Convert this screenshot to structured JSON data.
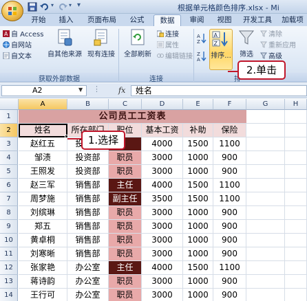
{
  "window": {
    "title": "根据单元格颜色排序.xlsx - Mi"
  },
  "tabs": [
    {
      "label": "开始"
    },
    {
      "label": "插入"
    },
    {
      "label": "页面布局"
    },
    {
      "label": "公式"
    },
    {
      "label": "数据",
      "active": true
    },
    {
      "label": "审阅"
    },
    {
      "label": "视图"
    },
    {
      "label": "开发工具"
    },
    {
      "label": "加载项"
    }
  ],
  "ribbon": {
    "get_external": {
      "caption": "获取外部数据",
      "access": "自 Access",
      "web": "自网站",
      "text": "自文本",
      "other_sources": "自其他来源",
      "existing": "现有连接"
    },
    "connections": {
      "caption": "连接",
      "refresh_all": "全部刷新",
      "connections": "连接",
      "properties": "属性",
      "edit_links": "编辑链接"
    },
    "sort_filter": {
      "caption": "排",
      "sort": "排序...",
      "filter": "筛选",
      "clear": "清除",
      "reapply": "重新应用",
      "advanced": "高级"
    }
  },
  "formula_bar": {
    "name_box": "A2",
    "fx": "fx",
    "content": "姓名"
  },
  "sheet": {
    "columns": [
      "A",
      "B",
      "C",
      "D",
      "E",
      "F",
      "G",
      "H"
    ],
    "title": "公司员工工资表",
    "headers": [
      "姓名",
      "所在部门",
      "职位",
      "基本工资",
      "补助",
      "保险"
    ],
    "rows": [
      {
        "n": "1"
      },
      {
        "n": "2"
      },
      {
        "n": "3",
        "cells": [
          "赵红五",
          "投资部",
          "",
          "4000",
          "1500",
          "1100"
        ],
        "post_style": "post-dark"
      },
      {
        "n": "4",
        "cells": [
          "邹渍",
          "投资部",
          "职员",
          "3000",
          "1000",
          "900"
        ],
        "post_style": "post"
      },
      {
        "n": "5",
        "cells": [
          "王照发",
          "投资部",
          "职员",
          "3000",
          "1000",
          "900"
        ],
        "post_style": "post"
      },
      {
        "n": "6",
        "cells": [
          "赵三军",
          "销售部",
          "主任",
          "4000",
          "1500",
          "1100"
        ],
        "post_style": "post-dark"
      },
      {
        "n": "7",
        "cells": [
          "周梦施",
          "销售部",
          "副主任",
          "3500",
          "1500",
          "1100"
        ],
        "post_style": "post-dark"
      },
      {
        "n": "8",
        "cells": [
          "刘缤琳",
          "销售部",
          "职员",
          "3000",
          "1000",
          "900"
        ],
        "post_style": "post"
      },
      {
        "n": "9",
        "cells": [
          "郑五",
          "销售部",
          "职员",
          "3000",
          "1000",
          "900"
        ],
        "post_style": "post"
      },
      {
        "n": "10",
        "cells": [
          "黄卓桐",
          "销售部",
          "职员",
          "3000",
          "1000",
          "900"
        ],
        "post_style": "post"
      },
      {
        "n": "11",
        "cells": [
          "刘寒晰",
          "销售部",
          "职员",
          "3000",
          "1000",
          "900"
        ],
        "post_style": "post"
      },
      {
        "n": "12",
        "cells": [
          "张家艳",
          "办公室",
          "主任",
          "4000",
          "1500",
          "1100"
        ],
        "post_style": "post-dark"
      },
      {
        "n": "13",
        "cells": [
          "蒋诗韵",
          "办公室",
          "职员",
          "3000",
          "1000",
          "900"
        ],
        "post_style": "post"
      },
      {
        "n": "14",
        "cells": [
          "王行可",
          "办公室",
          "职员",
          "3000",
          "1000",
          "900"
        ],
        "post_style": "post"
      }
    ]
  },
  "callouts": {
    "select": "1.选择",
    "click": "2.单击"
  },
  "colors": {
    "title_fill": "#d9a2a2",
    "post_fill": "#e8a9a9",
    "post_dark_fill": "#5a1713",
    "callout_border": "#c0162a"
  }
}
